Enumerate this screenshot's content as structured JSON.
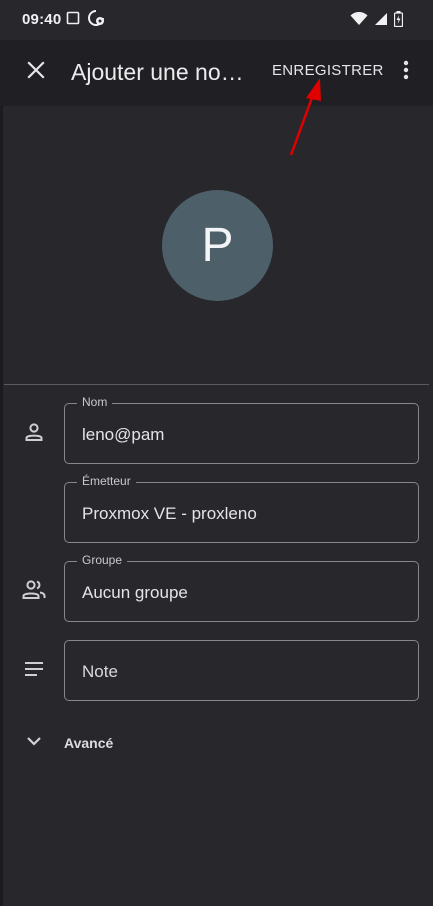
{
  "status_bar": {
    "time": "09:40",
    "icons_left": [
      "screenshot-icon",
      "sync-settings-icon"
    ],
    "icons_right": [
      "wifi-icon",
      "signal-icon",
      "battery-icon"
    ]
  },
  "app_bar": {
    "close_icon": "close-icon",
    "title": "Ajouter une no…",
    "save_label": "ENREGISTRER",
    "more_icon": "more-vert-icon"
  },
  "avatar": {
    "letter": "P",
    "color": "#4d5f69"
  },
  "form": {
    "name": {
      "label": "Nom",
      "value": "leno@pam",
      "icon": "person-icon"
    },
    "issuer": {
      "label": "Émetteur",
      "value": "Proxmox VE - proxleno"
    },
    "group": {
      "label": "Groupe",
      "value": "Aucun groupe",
      "icon": "group-icon"
    },
    "note": {
      "placeholder": "Note",
      "icon": "notes-icon"
    }
  },
  "advanced": {
    "label": "Avancé",
    "icon": "chevron-down-icon"
  },
  "colors": {
    "background": "#27272c",
    "app_bar": "#202024",
    "annotation": "#e00000"
  }
}
